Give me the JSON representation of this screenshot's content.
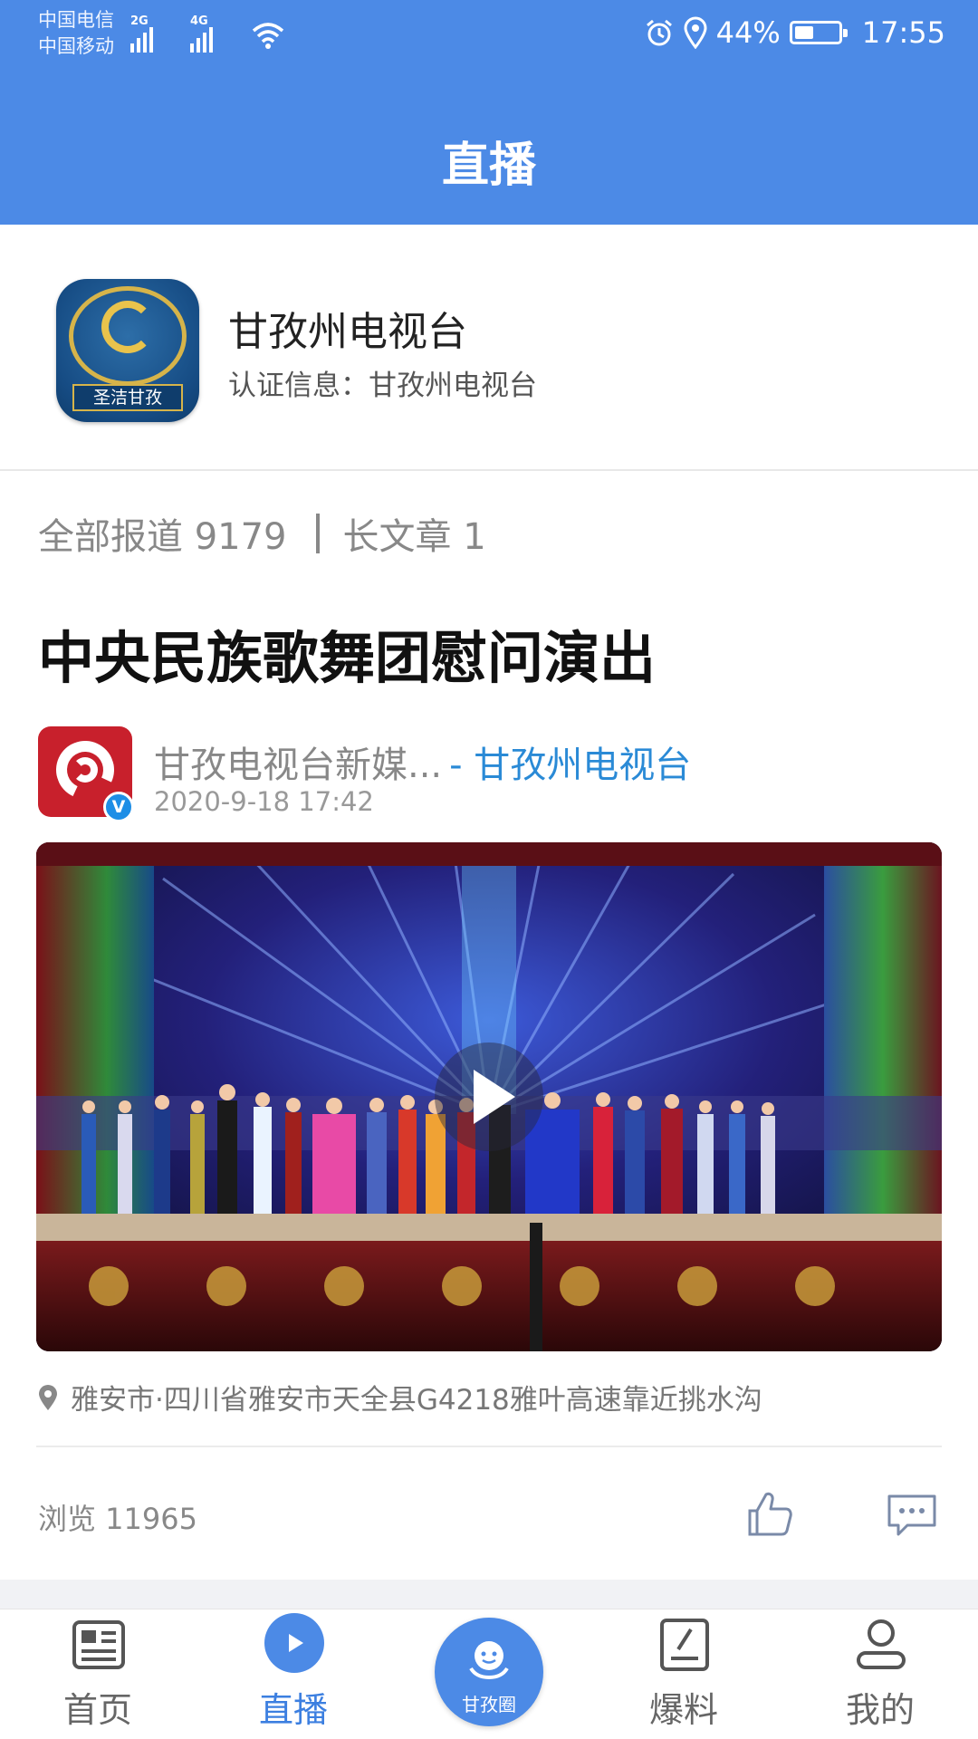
{
  "status_bar": {
    "carrier_1": "中国电信",
    "carrier_2": "中国移动",
    "net_1": "2G",
    "net_2": "4G",
    "battery_percent": "44%",
    "battery_level": 0.44,
    "time": "17:55"
  },
  "header": {
    "title": "直播"
  },
  "channel": {
    "name": "甘孜州电视台",
    "verification": "认证信息：甘孜州电视台",
    "logo_motto": "圣洁甘孜"
  },
  "stats": {
    "all_reports": "全部报道 9179",
    "long_articles": "长文章 1"
  },
  "article": {
    "title": "中央民族歌舞团慰问演出",
    "author_name": "甘孜电视台新媒...",
    "author_channel": "- 甘孜州电视台",
    "verified_badge": "V",
    "date": "2020-9-18 17:42",
    "location": "雅安市·四川省雅安市天全县G4218雅叶高速靠近挑水沟",
    "views": "浏览 11965"
  },
  "bottom_nav": {
    "items": [
      {
        "label": "首页",
        "icon": "news-icon"
      },
      {
        "label": "直播",
        "icon": "play-circle-icon",
        "active": true
      },
      {
        "label": "爆料",
        "icon": "edit-icon"
      },
      {
        "label": "我的",
        "icon": "user-icon"
      }
    ],
    "center": {
      "label": "甘孜圈",
      "icon": "ganzi-circle-icon"
    }
  },
  "colors": {
    "primary": "#4c8ae6",
    "link": "#2a8ad6",
    "active_nav": "#3c7fe0"
  }
}
